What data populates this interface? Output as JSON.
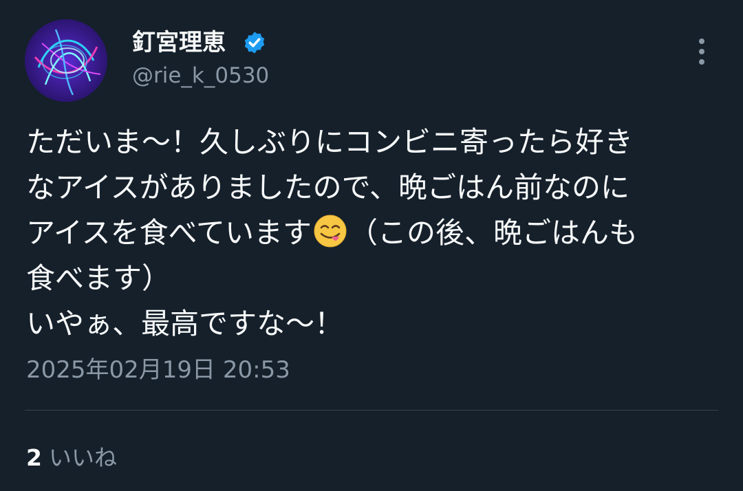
{
  "user": {
    "display_name": "釘宮理恵",
    "handle": "@rie_k_0530",
    "verified_icon": "verified-badge-icon",
    "avatar": "avatar-neon-light-swirl"
  },
  "tweet": {
    "lines": [
      "ただいま～！久しぶりにコンビニ寄ったら好き",
      "なアイスがありましたので、晩ごはん前なのに",
      "アイスを食べています",
      "（この後、晩ごはんも",
      "食べます）",
      "いやぁ、最高ですな～！"
    ],
    "emoji": "face-savoring-food-emoji",
    "timestamp": "2025年02月19日 20:53"
  },
  "engagement": {
    "likes_count": "2",
    "likes_label": "いいね"
  },
  "colors": {
    "background": "#15202b",
    "text_primary": "#f7f9f9",
    "text_secondary": "#8b98a5",
    "divider": "#38444d",
    "verified": "#1d9bf0"
  },
  "icons": {
    "more": "more-vertical-icon"
  }
}
